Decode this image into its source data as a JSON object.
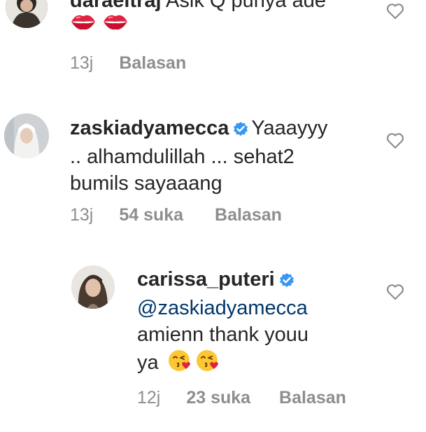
{
  "comments": [
    {
      "username": "daraeitraj",
      "text": "Asik Q punya ade",
      "emojis": [
        "kiss-mark-icon",
        "kiss-mark-icon"
      ],
      "time": "13j",
      "likes": "",
      "reply_label": "Balasan"
    },
    {
      "username": "zaskiadyamecca",
      "verified": true,
      "text_line1": "Yaaayyy",
      "text_line2": ".. alhamdulillah ... sehat2",
      "text_line3": "bumils sayaaang",
      "time": "13j",
      "likes": "54 suka",
      "reply_label": "Balasan"
    },
    {
      "username": "carissa_puteri",
      "verified": true,
      "mention": "@zaskiadyamecca",
      "text_line1": "amienn thank youu",
      "text_line2": "ya",
      "emojis": [
        "face-blowing-kiss-icon",
        "face-blowing-kiss-icon"
      ],
      "time": "12j",
      "likes": "23 suka",
      "reply_label": "Balasan"
    }
  ],
  "colors": {
    "text": "#262626",
    "meta": "#8e8e8e",
    "mention": "#00376b",
    "verified": "#3897f0"
  }
}
